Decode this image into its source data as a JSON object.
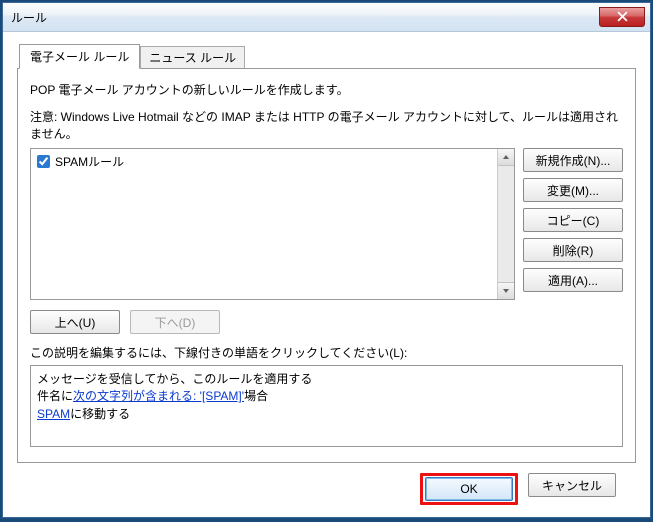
{
  "window": {
    "title": "ルール"
  },
  "tabs": {
    "email": "電子メール ルール",
    "news": "ニュース ルール"
  },
  "instructions": "POP 電子メール アカウントの新しいルールを作成します。",
  "note": "注意: Windows Live Hotmail などの IMAP または HTTP の電子メール アカウントに対して、ルールは適用されません。",
  "rules": [
    {
      "checked": true,
      "name": "SPAMルール"
    }
  ],
  "sideButtons": {
    "new": "新規作成(N)...",
    "modify": "変更(M)...",
    "copy": "コピー(C)",
    "delete": "削除(R)",
    "apply": "適用(A)..."
  },
  "reorder": {
    "up": "上へ(U)",
    "down": "下へ(D)"
  },
  "descriptionLabel": "この説明を編集するには、下線付きの単語をクリックしてください(L):",
  "description": {
    "line1": "メッセージを受信してから、このルールを適用する",
    "line2_prefix": "件名に",
    "line2_link": "次の文字列が含まれる: '[SPAM]'",
    "line2_suffix": "場合",
    "line3_link": "SPAM",
    "line3_suffix": "に移動する"
  },
  "bottom": {
    "ok": "OK",
    "cancel": "キャンセル"
  }
}
